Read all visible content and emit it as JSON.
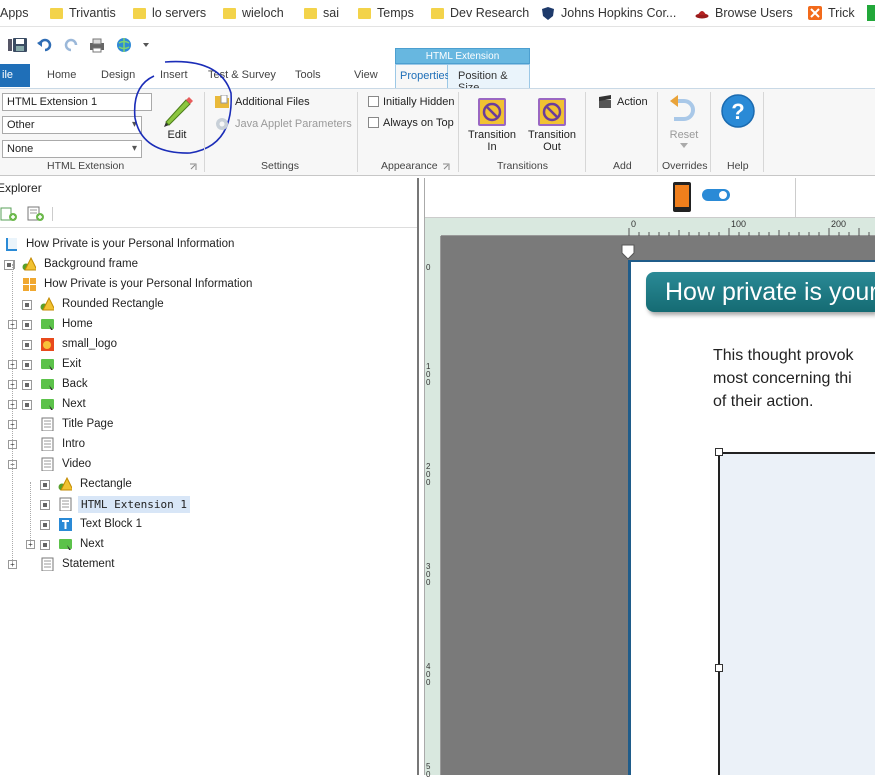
{
  "bookmarks": [
    {
      "label": "Apps",
      "icon": "apps-grid-icon"
    },
    {
      "label": "Trivantis",
      "icon": "folder-icon"
    },
    {
      "label": "lo servers",
      "icon": "folder-icon"
    },
    {
      "label": "wieloch",
      "icon": "folder-icon"
    },
    {
      "label": "sai",
      "icon": "folder-icon"
    },
    {
      "label": "Temps",
      "icon": "folder-icon"
    },
    {
      "label": "Dev Research",
      "icon": "folder-icon"
    },
    {
      "label": "Johns Hopkins Cor...",
      "icon": "shield-logo-icon"
    },
    {
      "label": "Browse Users",
      "icon": "fedora-hat-icon"
    },
    {
      "label": "Trick",
      "icon": "x-badge-icon"
    }
  ],
  "ribbon": {
    "context_band": "HTML Extension",
    "file_tab": "ile",
    "tabs": [
      "Home",
      "Design",
      "Insert",
      "Test & Survey",
      "Tools",
      "View"
    ],
    "context_tabs": [
      "Properties",
      "Position & Size"
    ],
    "name_field": "HTML Extension 1",
    "type_select": "Other",
    "none_select": "None",
    "edit_label": "Edit",
    "groups": {
      "html_extension": "HTML Extension",
      "settings": "Settings",
      "appearance": "Appearance",
      "transitions": "Transitions",
      "add": "Add",
      "overrides": "Overrides",
      "help": "Help"
    },
    "additional_files": "Additional Files",
    "java_applet": "Java Applet Parameters",
    "initially_hidden": "Initially Hidden",
    "always_on_top": "Always on Top",
    "transition_in": "Transition In",
    "transition_out": "Transition Out",
    "action": "Action",
    "reset": "Reset"
  },
  "explorer": {
    "title": "Explorer",
    "items": [
      {
        "label": "How Private is your Personal Information"
      },
      {
        "label": "Background frame"
      },
      {
        "label": "How Private is your Personal Information"
      },
      {
        "label": "Rounded Rectangle"
      },
      {
        "label": "Home"
      },
      {
        "label": "small_logo"
      },
      {
        "label": "Exit"
      },
      {
        "label": "Back"
      },
      {
        "label": "Next"
      },
      {
        "label": "Title Page"
      },
      {
        "label": "Intro"
      },
      {
        "label": "Video"
      },
      {
        "label": "Rectangle"
      },
      {
        "label": "HTML Extension 1"
      },
      {
        "label": "Text Block 1"
      },
      {
        "label": "Next"
      },
      {
        "label": "Statement"
      }
    ]
  },
  "canvas": {
    "ruler_h": [
      "0",
      "100",
      "200"
    ],
    "ruler_v": [
      "0",
      "1 0 0",
      "2 0 0",
      "3 0 0",
      "4 0 0",
      "5 0"
    ],
    "title": "How private is your",
    "body_lines": [
      "This thought provok",
      "most concerning thi",
      "of their action."
    ]
  },
  "colors": {
    "accent": "#1f6fb8",
    "banner": "#1e7b85",
    "annotation": "#1b2db8"
  }
}
